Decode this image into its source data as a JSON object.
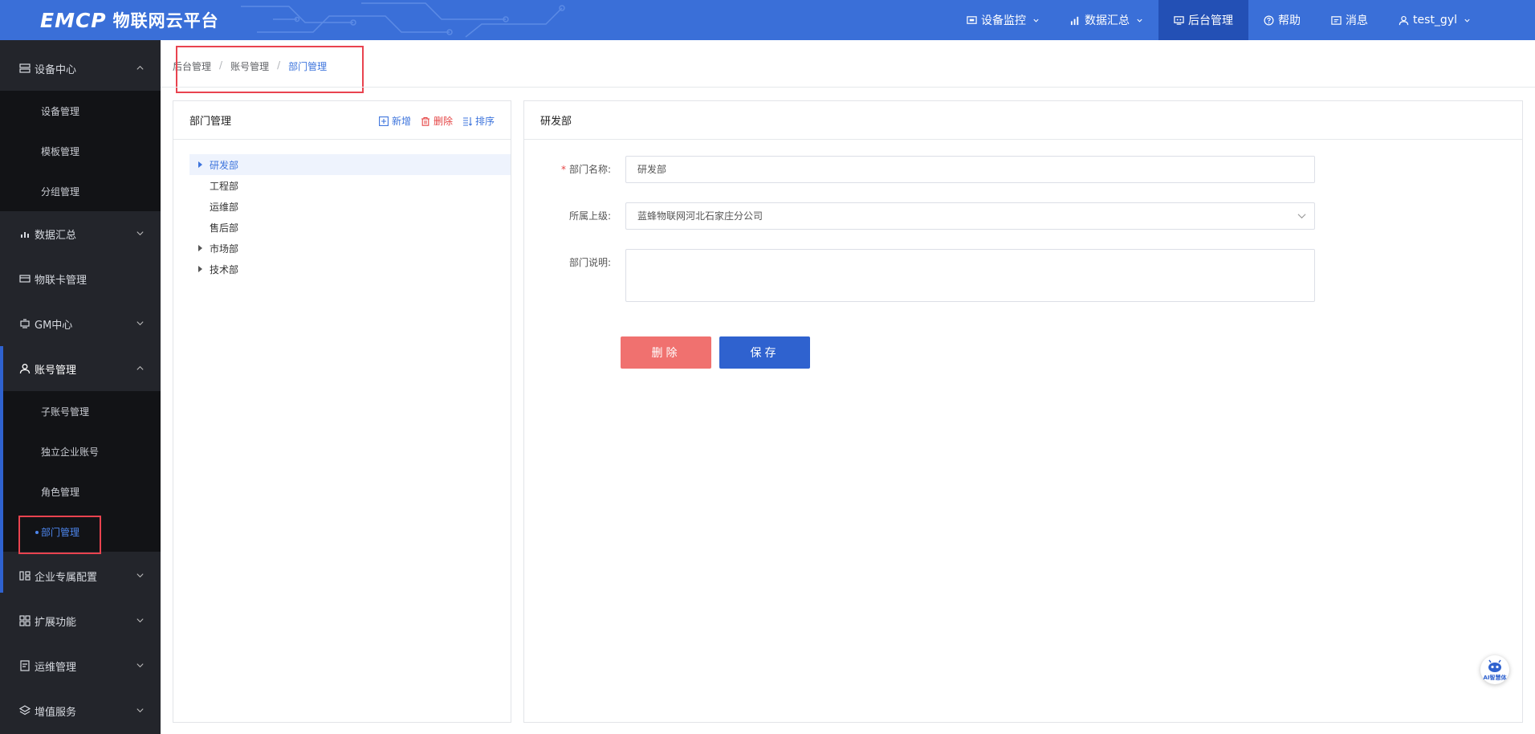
{
  "header": {
    "logo_mark": "EMCP",
    "logo_title": "物联网云平台",
    "nav": [
      {
        "label": "设备监控",
        "icon": "monitor-icon",
        "dropdown": true
      },
      {
        "label": "数据汇总",
        "icon": "bar-chart-icon",
        "dropdown": true
      },
      {
        "label": "后台管理",
        "icon": "admin-icon",
        "dropdown": false,
        "active": true
      },
      {
        "label": "帮助",
        "icon": "help-icon",
        "dropdown": false
      },
      {
        "label": "消息",
        "icon": "message-icon",
        "dropdown": false
      },
      {
        "label": "test_gyl",
        "icon": "user-icon",
        "dropdown": true
      }
    ]
  },
  "sidebar": {
    "groups": [
      {
        "label": "设备中心",
        "icon": "device-icon",
        "expanded": true,
        "items": [
          "设备管理",
          "模板管理",
          "分组管理"
        ]
      },
      {
        "label": "数据汇总",
        "icon": "chart-icon",
        "expanded": false
      },
      {
        "label": "物联卡管理",
        "icon": "card-icon",
        "expanded": false
      },
      {
        "label": "GM中心",
        "icon": "gm-icon",
        "expanded": false
      },
      {
        "label": "账号管理",
        "icon": "account-icon",
        "expanded": true,
        "items": [
          "子账号管理",
          "独立企业账号",
          "角色管理",
          "部门管理"
        ],
        "active_item": "部门管理"
      },
      {
        "label": "企业专属配置",
        "icon": "config-icon",
        "expanded": false
      },
      {
        "label": "扩展功能",
        "icon": "extend-icon",
        "expanded": false
      },
      {
        "label": "运维管理",
        "icon": "ops-icon",
        "expanded": false
      },
      {
        "label": "增值服务",
        "icon": "service-icon",
        "expanded": false
      }
    ]
  },
  "breadcrumb": [
    "后台管理",
    "账号管理",
    "部门管理"
  ],
  "dept_panel": {
    "title": "部门管理",
    "tools": {
      "add": "新增",
      "delete": "删除",
      "sort": "排序"
    },
    "tree": [
      {
        "label": "研发部",
        "has_children": true,
        "selected": true
      },
      {
        "label": "工程部",
        "has_children": false
      },
      {
        "label": "运维部",
        "has_children": false
      },
      {
        "label": "售后部",
        "has_children": false
      },
      {
        "label": "市场部",
        "has_children": true
      },
      {
        "label": "技术部",
        "has_children": true
      }
    ]
  },
  "detail_panel": {
    "title": "研发部",
    "fields": {
      "name_label": "部门名称:",
      "name_value": "研发部",
      "parent_label": "所属上级:",
      "parent_value": "蓝蜂物联网河北石家庄分公司",
      "desc_label": "部门说明:",
      "desc_value": ""
    },
    "buttons": {
      "delete": "删除",
      "save": "保存"
    }
  },
  "ai_badge": {
    "label": "AI智慧体"
  },
  "colors": {
    "header": "#3a6fd8",
    "sidebar": "#23252b",
    "accent": "#2f62cf",
    "danger": "#f0716f",
    "highlight": "#e9434f"
  }
}
